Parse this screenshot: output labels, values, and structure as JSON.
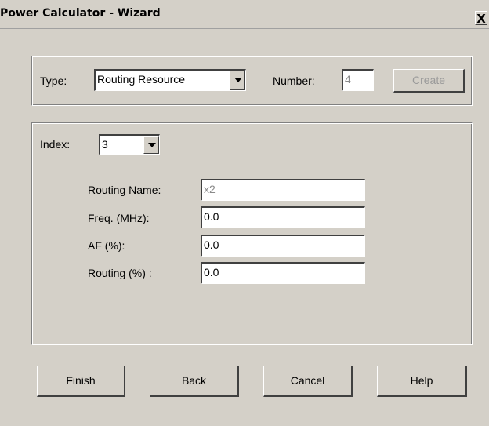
{
  "window": {
    "title": "Power Calculator - Wizard",
    "close_glyph": "X"
  },
  "type_group": {
    "type_label": "Type:",
    "type_value": "Routing Resource",
    "number_label": "Number:",
    "number_value": "4",
    "create_label": "Create"
  },
  "details_group": {
    "index_label": "Index:",
    "index_value": "3",
    "fields": [
      {
        "label": "Routing Name:",
        "value": "x2",
        "disabled": true
      },
      {
        "label": "Freq. (MHz):",
        "value": "0.0",
        "disabled": false
      },
      {
        "label": "AF (%):",
        "value": "0.0",
        "disabled": false
      },
      {
        "label": "Routing (%) :",
        "value": "0.0",
        "disabled": false
      }
    ]
  },
  "buttons": {
    "finish": "Finish",
    "back": "Back",
    "cancel": "Cancel",
    "help": "Help"
  },
  "icons": {
    "close": "close-icon",
    "dropdown": "chevron-down-icon"
  }
}
